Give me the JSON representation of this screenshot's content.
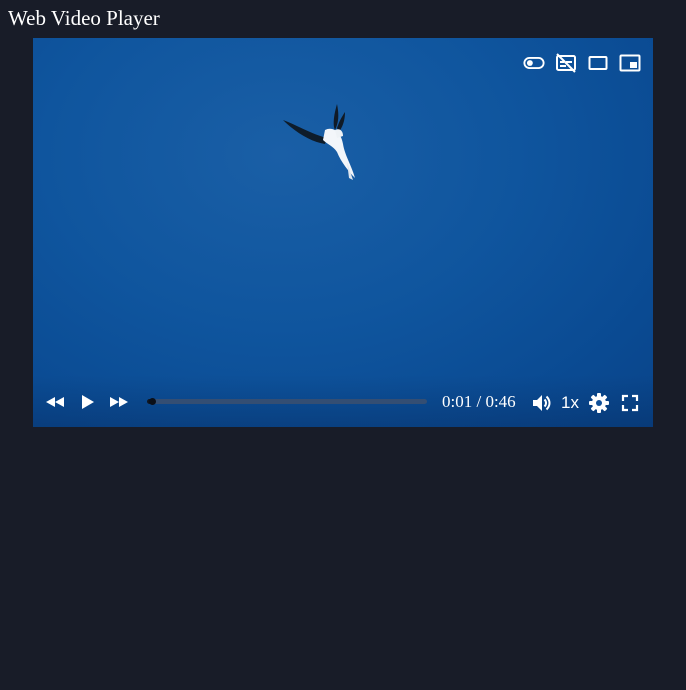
{
  "page": {
    "title": "Web Video Player"
  },
  "player": {
    "current_time": "0:01",
    "separator": "/",
    "duration": "0:46",
    "time_display": "0:01 / 0:46",
    "speed_label": "1x",
    "progress_fraction": 0.018,
    "colors": {
      "icon": "#ffffff",
      "progress_track": "#3c506e",
      "progress_fill": "#0d1522",
      "background": "#181c28"
    },
    "top_icons": [
      "toggle-icon",
      "captions-off-icon",
      "theater-mode-icon",
      "picture-in-picture-icon"
    ],
    "left_icons": [
      "rewind-icon",
      "play-icon",
      "fast-forward-icon"
    ],
    "right_icons": [
      "volume-icon",
      "settings-gear-icon",
      "fullscreen-icon"
    ]
  }
}
